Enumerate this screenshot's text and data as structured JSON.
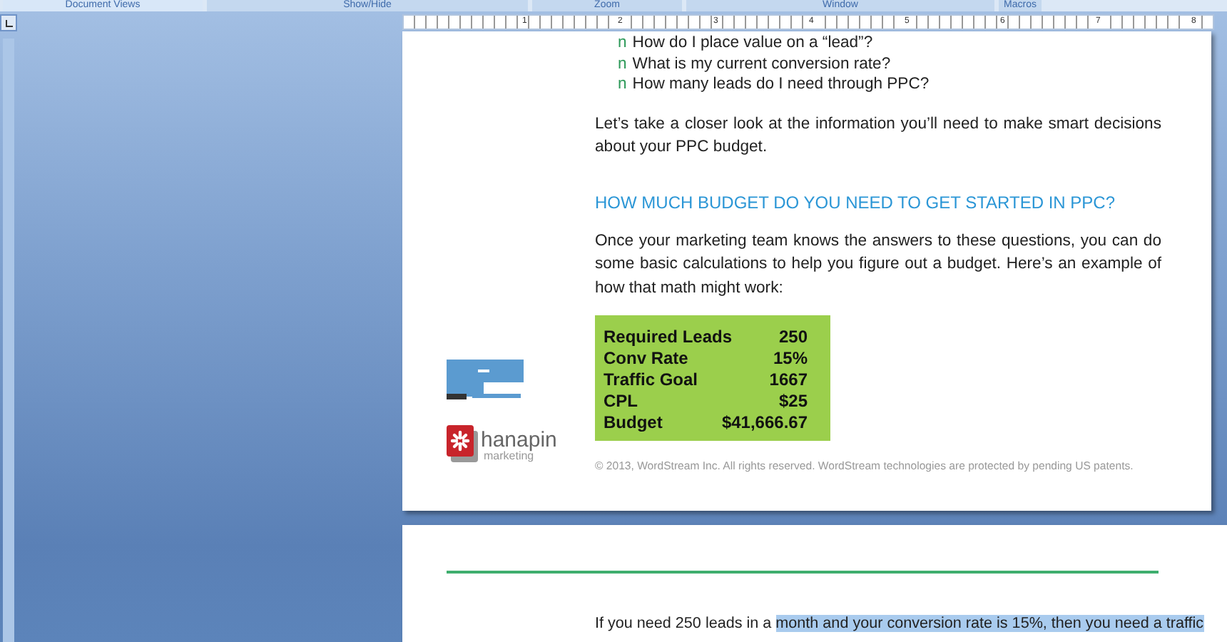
{
  "ribbon_groups": [
    {
      "label": "Document Views",
      "selected": true
    },
    {
      "label": "Show/Hide",
      "selected": false
    },
    {
      "label": "Zoom",
      "selected": false
    },
    {
      "label": "Window",
      "selected": false
    },
    {
      "label": "Macros",
      "selected": false
    }
  ],
  "ruler": {
    "labels": [
      "1",
      "2",
      "3",
      "4",
      "5",
      "6",
      "7",
      "8"
    ]
  },
  "page_1": {
    "bullets": [
      {
        "marker": "n",
        "text": "How do I place value on a “lead”?"
      },
      {
        "marker": "n",
        "text": "What is my current conversion rate?"
      },
      {
        "marker": "n",
        "text": "How many leads do I need through PPC?"
      }
    ],
    "intro": "Let’s take a closer look at the information you’ll need to make smart decisions about your PPC budget.",
    "heading": "HOW MUCH BUDGET DO YOU NEED TO GET STARTED IN PPC?",
    "paragraph": "Once your marketing team knows the answers to these questions, you can do some basic calculations to help you figure out a budget. Here’s an example of how that math might work:",
    "table": {
      "rows": [
        {
          "label": "Required Leads",
          "value": "250"
        },
        {
          "label": "Conv Rate",
          "value": "15%"
        },
        {
          "label": "Traffic Goal",
          "value": "1667"
        },
        {
          "label": "CPL",
          "value": "$25"
        },
        {
          "label": "Budget",
          "value": "$41,666.67"
        }
      ]
    },
    "logo_2": {
      "name": "hanapin",
      "tagline": "marketing"
    },
    "footer": "© 2013, WordStream Inc. All rights reserved. WordStream technologies are protected by pending US patents."
  },
  "page_2": {
    "segments": [
      {
        "text": "If you need 250 leads in a ",
        "highlighted": false
      },
      {
        "text": "month and your conversion rate is 15%, then you need a traffic",
        "highlighted": true
      }
    ]
  }
}
